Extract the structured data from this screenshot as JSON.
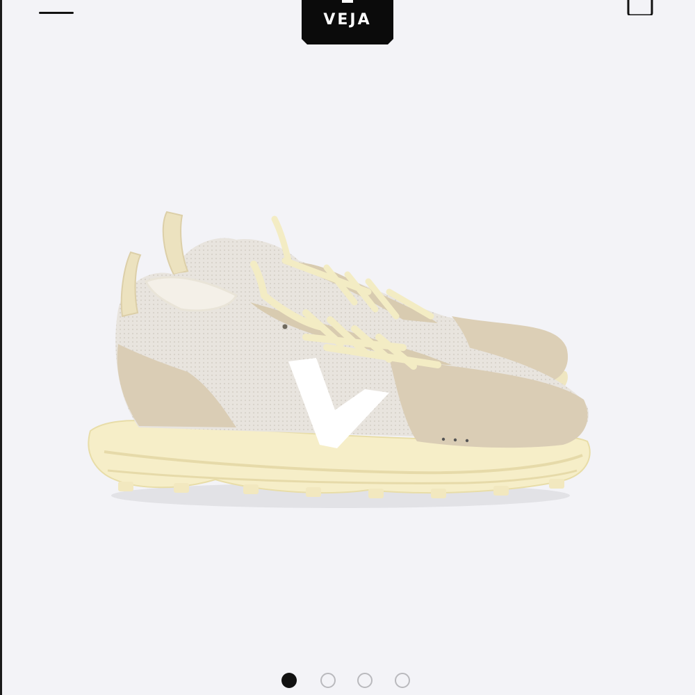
{
  "header": {
    "brand": "VEJA",
    "menu_icon": "hamburger-menu-icon",
    "cart_icon": "shopping-bag-icon"
  },
  "product": {
    "image_alt": "sneaker-pair-image",
    "colors": {
      "background": "#f3f3f7",
      "suede": "#dacdb5",
      "mesh": "#e9e5e0",
      "sole": "#f6eec8",
      "laces": "#f3ecc4",
      "logo_v": "#ffffff"
    }
  },
  "carousel": {
    "slide_count": 4,
    "active_index": 0
  }
}
